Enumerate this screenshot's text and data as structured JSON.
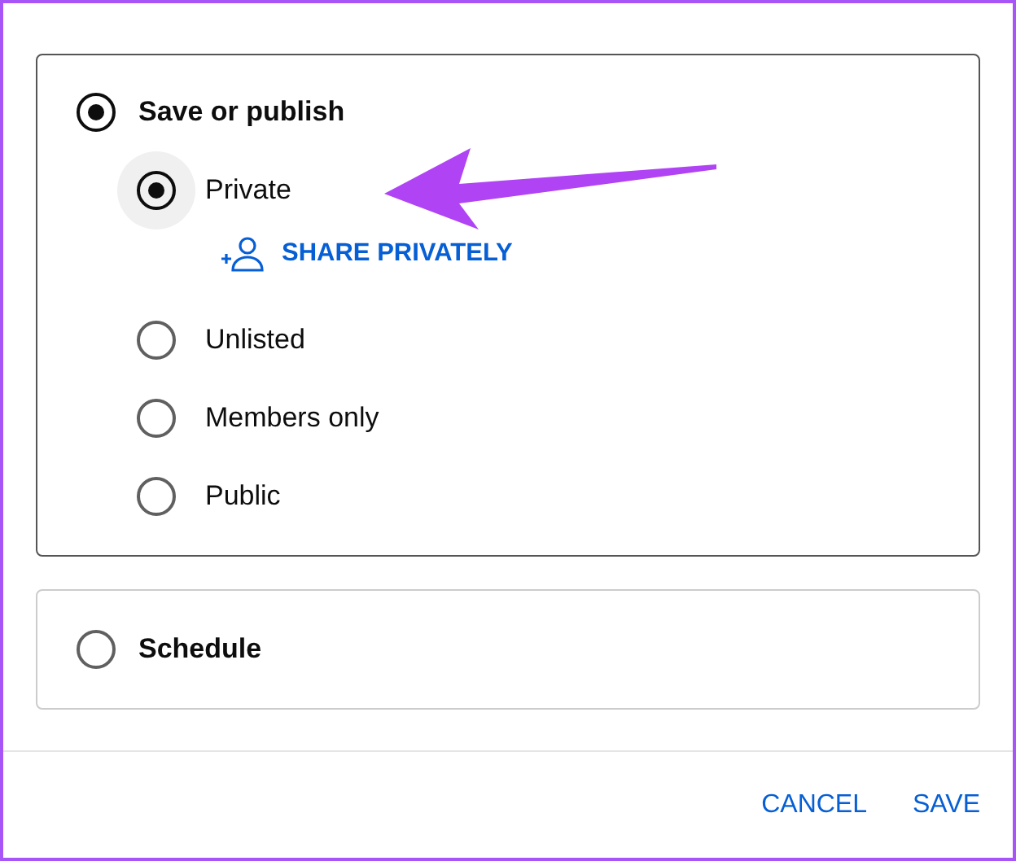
{
  "sections": [
    {
      "label": "Save or publish",
      "selected": true,
      "options": [
        {
          "label": "Private",
          "selected": true
        },
        {
          "label": "Unlisted",
          "selected": false
        },
        {
          "label": "Members only",
          "selected": false
        },
        {
          "label": "Public",
          "selected": false
        }
      ],
      "share_button": "SHARE PRIVATELY"
    },
    {
      "label": "Schedule",
      "selected": false
    }
  ],
  "buttons": [
    {
      "label": "CANCEL"
    },
    {
      "label": "SAVE"
    }
  ]
}
